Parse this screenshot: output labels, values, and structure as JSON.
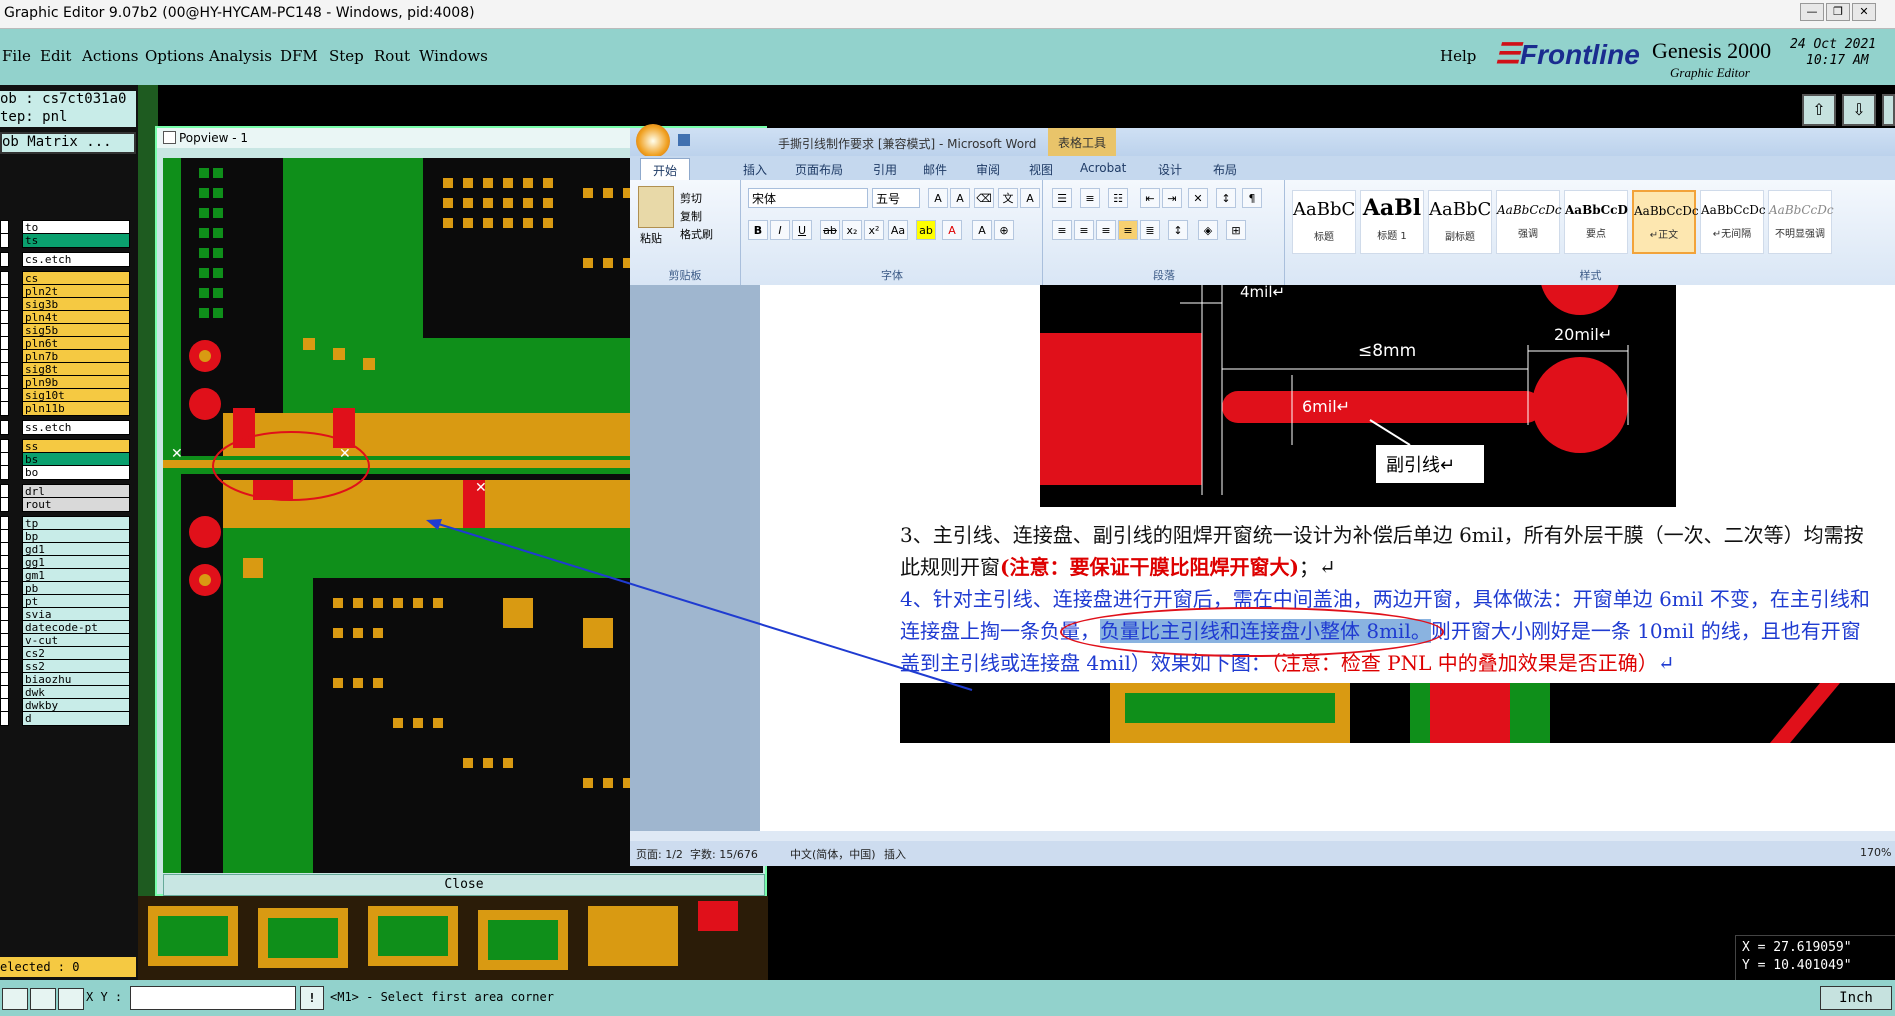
{
  "titlebar": {
    "title": "Graphic Editor 9.07b2 (00@HY-HYCAM-PC148 - Windows, pid:4008)",
    "minimize": "—",
    "restore": "❐",
    "close": "✕"
  },
  "menu": {
    "items": [
      "File",
      "Edit",
      "Actions",
      "Options",
      "Analysis",
      "DFM",
      "Step",
      "Rout",
      "Windows"
    ],
    "help": "Help"
  },
  "logo": {
    "brand": "Frontline",
    "product": "Genesis 2000",
    "subtitle": "Graphic Editor",
    "date": "24 Oct 2021",
    "time": "10:17 AM"
  },
  "job": {
    "job_line": "ob : cs7ct031a0",
    "step_line": "tep: pnl",
    "matrix_btn": "ob Matrix ..."
  },
  "layers": [
    {
      "name": "to",
      "color": "#ffffff"
    },
    {
      "name": "ts",
      "color": "#0aa06e"
    },
    {
      "name": "cs.etch",
      "color": "#ffffff"
    },
    {
      "name": "cs",
      "color": "#f5c942"
    },
    {
      "name": "pln2t",
      "color": "#f5c942"
    },
    {
      "name": "sig3b",
      "color": "#f5c942"
    },
    {
      "name": "pln4t",
      "color": "#f5c942"
    },
    {
      "name": "sig5b",
      "color": "#f5c942"
    },
    {
      "name": "pln6t",
      "color": "#f5c942"
    },
    {
      "name": "pln7b",
      "color": "#f5c942"
    },
    {
      "name": "sig8t",
      "color": "#f5c942"
    },
    {
      "name": "pln9b",
      "color": "#f5c942"
    },
    {
      "name": "sig10t",
      "color": "#f5c942"
    },
    {
      "name": "pln11b",
      "color": "#f5c942"
    },
    {
      "name": "ss.etch",
      "color": "#ffffff"
    },
    {
      "name": "ss",
      "color": "#f5c942"
    },
    {
      "name": "bs",
      "color": "#0aa06e"
    },
    {
      "name": "bo",
      "color": "#ffffff"
    },
    {
      "name": "drl",
      "color": "#d9d9d9"
    },
    {
      "name": "rout",
      "color": "#d9d9d9"
    },
    {
      "name": "tp",
      "color": "#c8ece8"
    },
    {
      "name": "bp",
      "color": "#c8ece8"
    },
    {
      "name": "gd1",
      "color": "#c8ece8"
    },
    {
      "name": "gg1",
      "color": "#c8ece8"
    },
    {
      "name": "gm1",
      "color": "#c8ece8"
    },
    {
      "name": "pb",
      "color": "#c8ece8"
    },
    {
      "name": "pt",
      "color": "#c8ece8"
    },
    {
      "name": "svia",
      "color": "#c8ece8"
    },
    {
      "name": "datecode-pt",
      "color": "#c8ece8"
    },
    {
      "name": "v-cut",
      "color": "#c8ece8"
    },
    {
      "name": "cs2",
      "color": "#c8ece8"
    },
    {
      "name": "ss2",
      "color": "#c8ece8"
    },
    {
      "name": "biaozhu",
      "color": "#c8ece8"
    },
    {
      "name": "dwk",
      "color": "#c8ece8"
    },
    {
      "name": "dwkby",
      "color": "#c8ece8"
    },
    {
      "name": "d",
      "color": "#c8ece8"
    }
  ],
  "popview": {
    "title": "Popview - 1",
    "close_label": "Close"
  },
  "word": {
    "title": "手撕引线制作要求 [兼容模式] - Microsoft Word",
    "context_tab": "表格工具",
    "tabs": [
      "开始",
      "插入",
      "页面布局",
      "引用",
      "邮件",
      "审阅",
      "视图",
      "Acrobat",
      "设计",
      "布局"
    ],
    "clipboard": {
      "paste": "粘贴",
      "cut": "剪切",
      "copy": "复制",
      "format_painter": "格式刷",
      "group": "剪贴板"
    },
    "font": {
      "name": "宋体",
      "size": "五号",
      "group": "字体"
    },
    "paragraph_group": "段落",
    "styles_group": "样式",
    "styles": [
      {
        "sample": "AaBbC",
        "name": "标题"
      },
      {
        "sample": "AaBl",
        "name": "标题 1"
      },
      {
        "sample": "AaBbC",
        "name": "副标题"
      },
      {
        "sample": "AaBbCcDc",
        "name": "强调"
      },
      {
        "sample": "AaBbCcD",
        "name": "要点"
      },
      {
        "sample": "AaBbCcDc",
        "name": "↵正文"
      },
      {
        "sample": "AaBbCcDc",
        "name": "↵无间隔"
      },
      {
        "sample": "AaBbCcDc",
        "name": "不明显强调"
      }
    ],
    "figure_labels": {
      "w4": "4mil↵",
      "len": "≤8mm",
      "w20": "20mil↵",
      "w6": "6mil↵",
      "callout": "副引线↵"
    },
    "para3_line1": "3、主引线、连接盘、副引线的阻焊开窗统一设计为补偿后单边 6mil，所有外层干膜（一次、二次等）均需按",
    "para3_line2_a": "此规则开窗",
    "para3_line2_b": "(注意：要保证干膜比阻焊开窗大)",
    "para3_line2_c": "；↵",
    "para4_line1": "4、针对主引线、连接盘进行开窗后，需在中间盖油，两边开窗，具体做法：开窗单边 6mil 不变，在主引线和",
    "para4_line2_a": "连接盘上掏一条负量，",
    "para4_line2_b": "负量比主引线和连接盘小整体 8mil。",
    "para4_line2_c": "则开窗大小刚好是一条 10mil 的线，且也有开窗",
    "para4_line3_a": "盖到主引线或连接盘 4mil）效果如下图：",
    "para4_line3_b": "（注意：检查 PNL 中的叠加效果是否正确）",
    "para4_line3_c": "↵",
    "status": {
      "page": "页面: 1/2",
      "words": "字数: 15/676",
      "lang": "中文(简体，中国)",
      "mode": "插入",
      "zoom": "170%"
    }
  },
  "coords": {
    "x": "X = 27.619059\"",
    "y": "Y = 10.401049\""
  },
  "selected": "elected : 0",
  "cmd": {
    "xy_label": "X Y :",
    "prompt": "<M1> - Select first area corner",
    "units": "Inch"
  },
  "colors": {
    "teal": "#92d2cc",
    "pcb_green": "#0f8f1a",
    "pcb_gold": "#d99a12",
    "pad_red": "#e0101a",
    "accent_blue": "#1f3bd1"
  }
}
